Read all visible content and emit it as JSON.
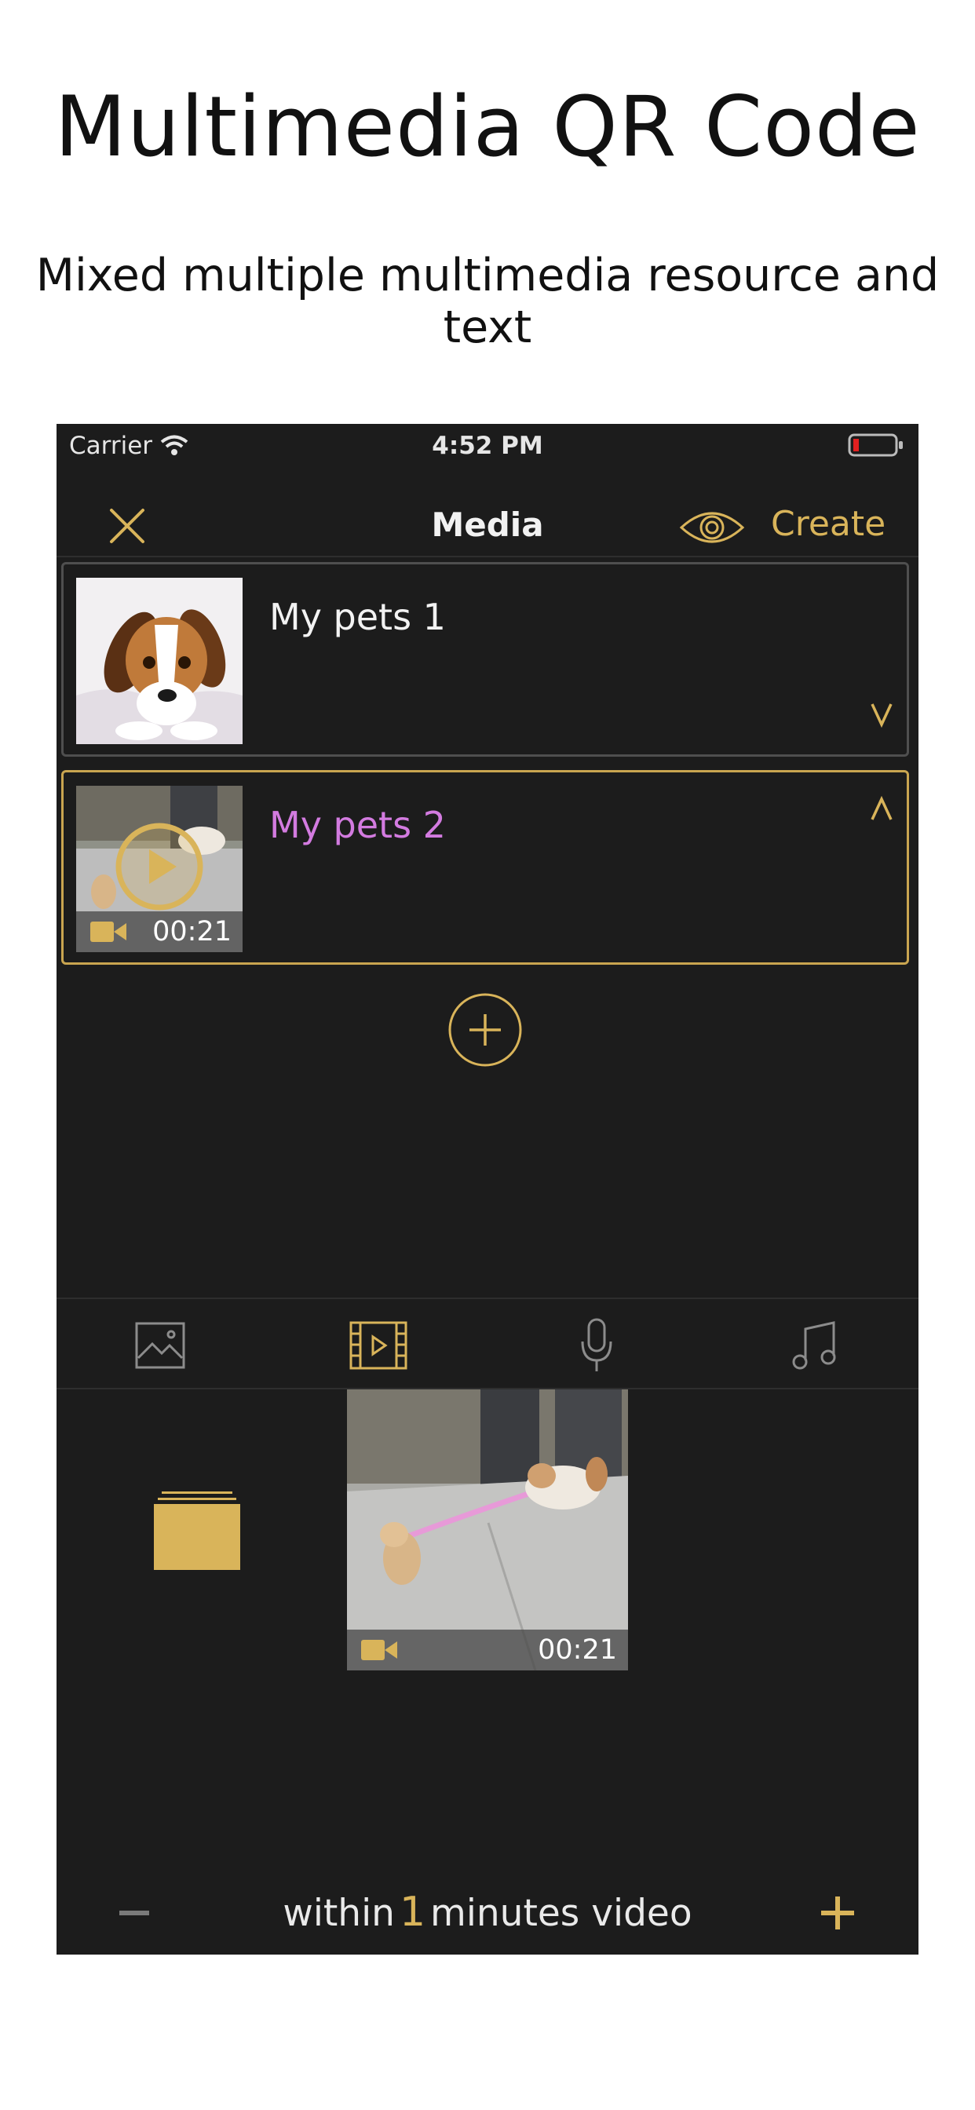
{
  "promo": {
    "title": "Multimedia QR Code",
    "subtitle": "Mixed multiple multimedia resource and text"
  },
  "status_bar": {
    "carrier": "Carrier",
    "time": "4:52 PM"
  },
  "nav": {
    "title": "Media",
    "create_label": "Create"
  },
  "media_items": [
    {
      "title": "My pets 1",
      "type": "image"
    },
    {
      "title": "My pets 2",
      "type": "video",
      "duration": "00:21"
    }
  ],
  "tabs": [
    "image-tab",
    "video-tab",
    "audio-tab",
    "music-tab"
  ],
  "active_tab": "video",
  "library": {
    "video_duration": "00:21"
  },
  "bottom_bar": {
    "prefix": "within",
    "limit": "1",
    "suffix": "minutes video"
  },
  "colors": {
    "accent": "#d9b45a",
    "selected_title": "#d37be0",
    "background": "#1c1c1c"
  }
}
